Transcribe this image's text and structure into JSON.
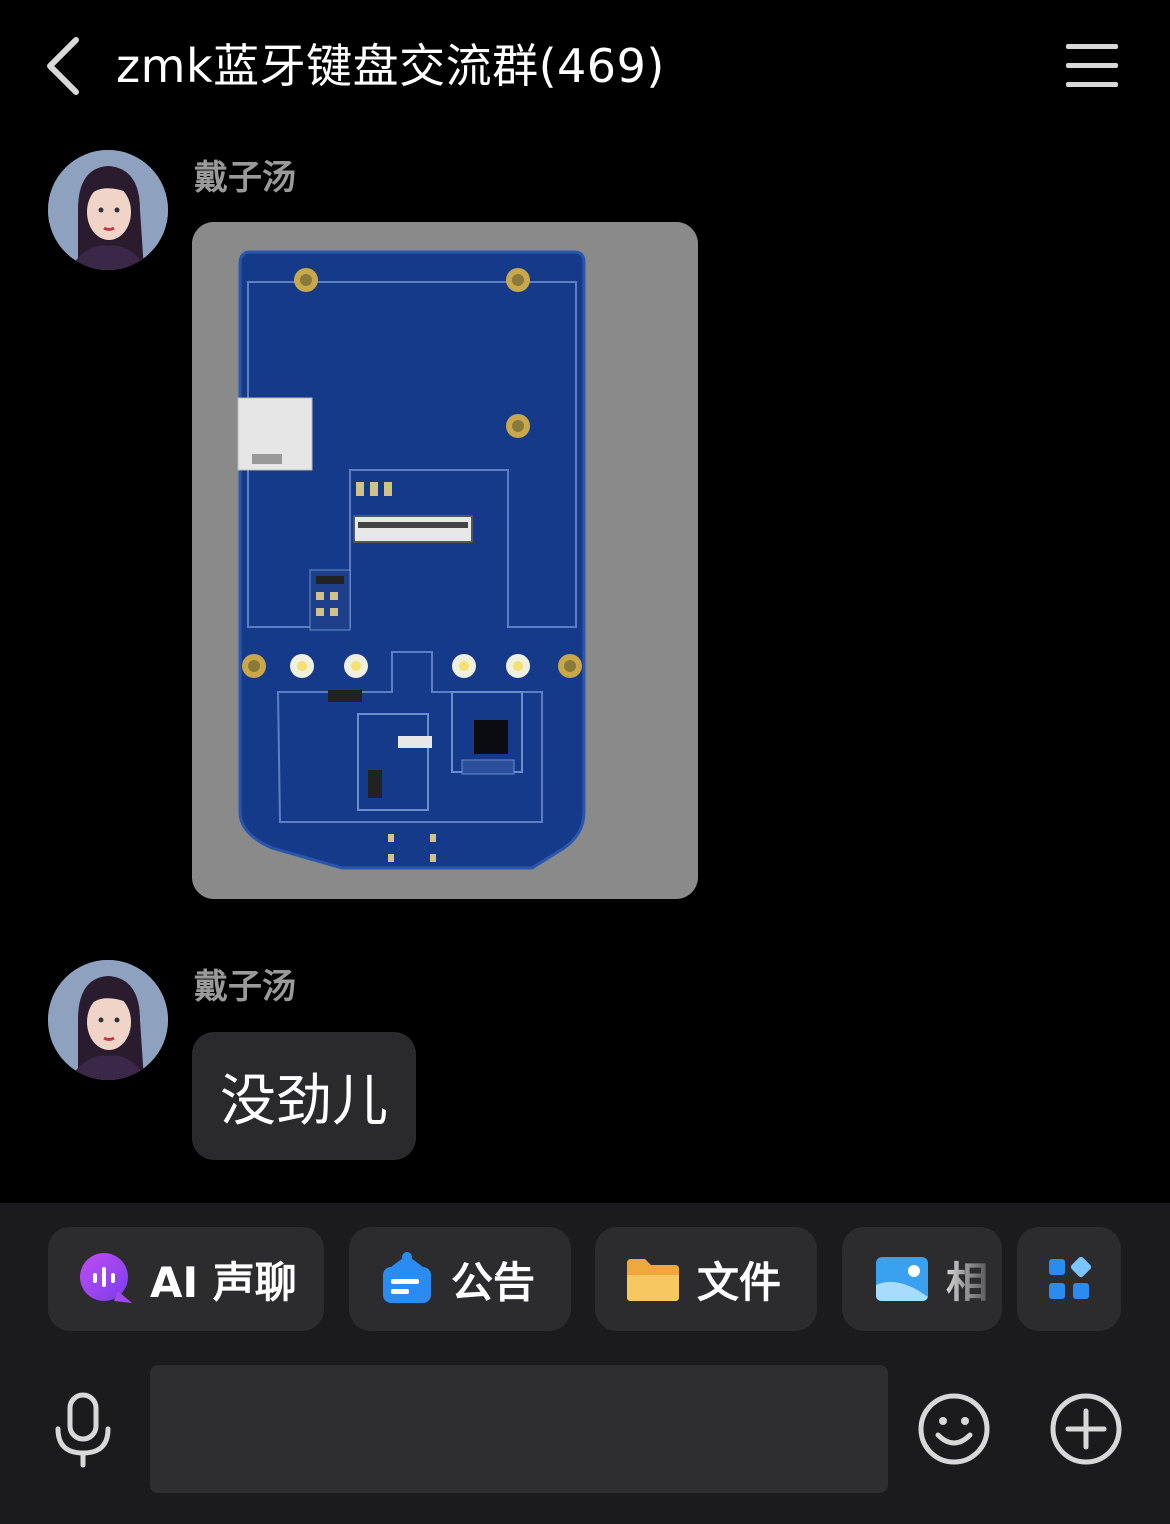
{
  "header": {
    "title": "zmk蓝牙键盘交流群(469)"
  },
  "messages": [
    {
      "sender": "戴子汤",
      "type": "image"
    },
    {
      "sender": "戴子汤",
      "type": "text",
      "text": "没劲儿"
    }
  ],
  "shortcuts": [
    {
      "label": "AI 声聊",
      "icon": "ai-voice-chat-icon"
    },
    {
      "label": "公告",
      "icon": "announcement-icon"
    },
    {
      "label": "文件",
      "icon": "folder-icon"
    },
    {
      "label": "相",
      "icon": "album-icon"
    },
    {
      "label": "",
      "icon": "apps-grid-icon"
    }
  ],
  "input": {
    "placeholder": ""
  },
  "colors": {
    "background": "#000000",
    "bottom_bar": "#1b1b1d",
    "chip": "#2c2c2e",
    "bubble": "#2a2a2c",
    "sender_name": "#9a9a9a",
    "pcb_blue": "#163a8a"
  }
}
